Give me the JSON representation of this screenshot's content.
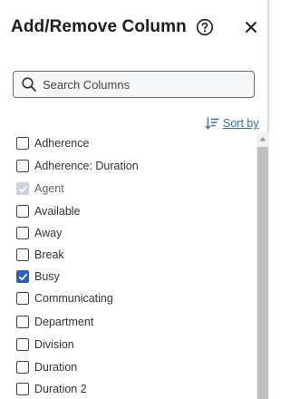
{
  "header": {
    "title": "Add/Remove Column"
  },
  "search": {
    "placeholder": "Search Columns",
    "value": ""
  },
  "sort": {
    "label": "Sort by"
  },
  "icons": {
    "help": "question-circle-icon",
    "close": "close-icon",
    "search": "search-icon",
    "sort": "sort-descending-icon"
  },
  "colors": {
    "accent": "#2a62b9",
    "link": "#2f6fb6",
    "disabled_check": "#c8d4e6"
  },
  "columns": [
    {
      "label": "Adherence",
      "checked": false,
      "disabled": false
    },
    {
      "label": "Adherence: Duration",
      "checked": false,
      "disabled": false
    },
    {
      "label": "Agent",
      "checked": true,
      "disabled": true
    },
    {
      "label": "Available",
      "checked": false,
      "disabled": false
    },
    {
      "label": "Away",
      "checked": false,
      "disabled": false
    },
    {
      "label": "Break",
      "checked": false,
      "disabled": false
    },
    {
      "label": "Busy",
      "checked": true,
      "disabled": false
    },
    {
      "label": "Communicating",
      "checked": false,
      "disabled": false
    },
    {
      "label": "Department",
      "checked": false,
      "disabled": false
    },
    {
      "label": "Division",
      "checked": false,
      "disabled": false
    },
    {
      "label": "Duration",
      "checked": false,
      "disabled": false
    },
    {
      "label": "Duration 2",
      "checked": false,
      "disabled": false
    }
  ]
}
